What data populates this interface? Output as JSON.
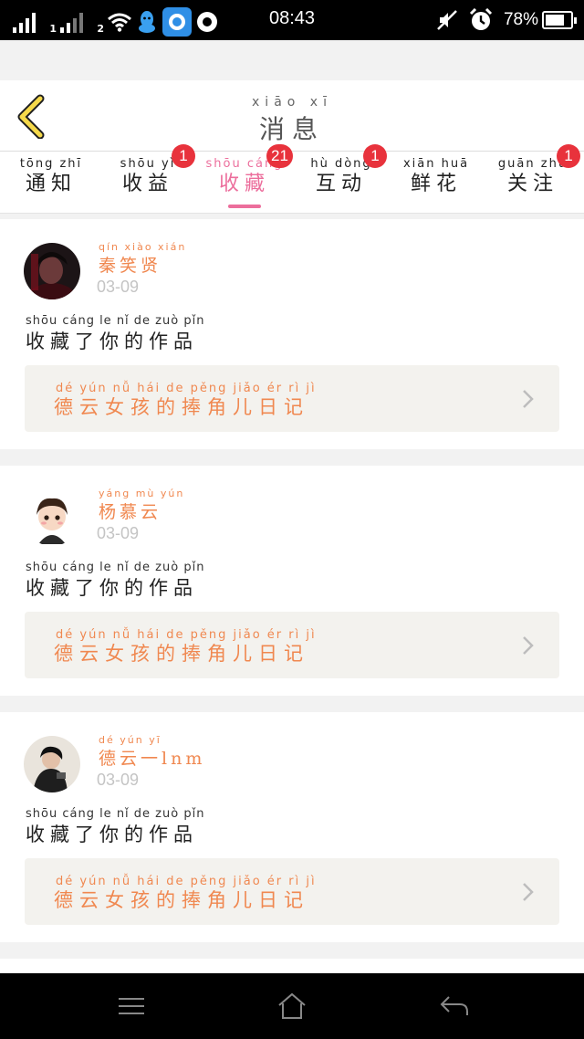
{
  "status_bar": {
    "sim1": "1",
    "sim2": "2",
    "time": "08:43",
    "battery": "78%",
    "battery_level": 0.78
  },
  "header": {
    "title_pinyin": "xiāo  xī",
    "title": "消息"
  },
  "tabs": [
    {
      "pinyin": "tōng  zhī",
      "label": "通知",
      "badge": ""
    },
    {
      "pinyin": "shōu  yì",
      "label": "收益",
      "badge": "1"
    },
    {
      "pinyin": "shōu cáng",
      "label": "收藏",
      "badge": "21",
      "active": true
    },
    {
      "pinyin": "hù  dòng",
      "label": "互动",
      "badge": "1"
    },
    {
      "pinyin": "xiān  huā",
      "label": "鲜花",
      "badge": ""
    },
    {
      "pinyin": "guān  zhù",
      "label": "关注",
      "badge": "1"
    }
  ],
  "messages": [
    {
      "user_pinyin": "qín  xiào  xián",
      "user": "秦笑贤",
      "date": "03-09",
      "text_pinyin": "shōu cáng   le    nǐ    de   zuò  pǐn",
      "text": "收藏了你的作品",
      "work_pinyin": "dé  yún  nǚ  hái  de pěng jiǎo  ér   rì   jì",
      "work_title": "德云女孩的捧角儿日记"
    },
    {
      "user_pinyin": "yáng  mù  yún",
      "user": "杨慕云",
      "date": "03-09",
      "text_pinyin": "shōu cáng   le    nǐ    de   zuò  pǐn",
      "text": "收藏了你的作品",
      "work_pinyin": "dé  yún  nǚ  hái  de pěng jiǎo  ér   rì   jì",
      "work_title": "德云女孩的捧角儿日记"
    },
    {
      "user_pinyin": "dé  yún  yī",
      "user": "德云一lnm",
      "date": "03-09",
      "text_pinyin": "shōu cáng   le    nǐ    de   zuò  pǐn",
      "text": "收藏了你的作品",
      "work_pinyin": "dé  yún  nǚ  hái  de pěng jiǎo  ér   rì   jì",
      "work_title": "德云女孩的捧角儿日记"
    }
  ],
  "colors": {
    "accent_pink": "#ec6e9c",
    "accent_orange": "#f08850",
    "badge_red": "#e8323c"
  },
  "icons": {
    "back": "chevron-left-icon",
    "row_arrow": "chevron-right-icon",
    "nav_menu": "menu-icon",
    "nav_home": "home-icon",
    "nav_back": "back-arrow-icon"
  }
}
